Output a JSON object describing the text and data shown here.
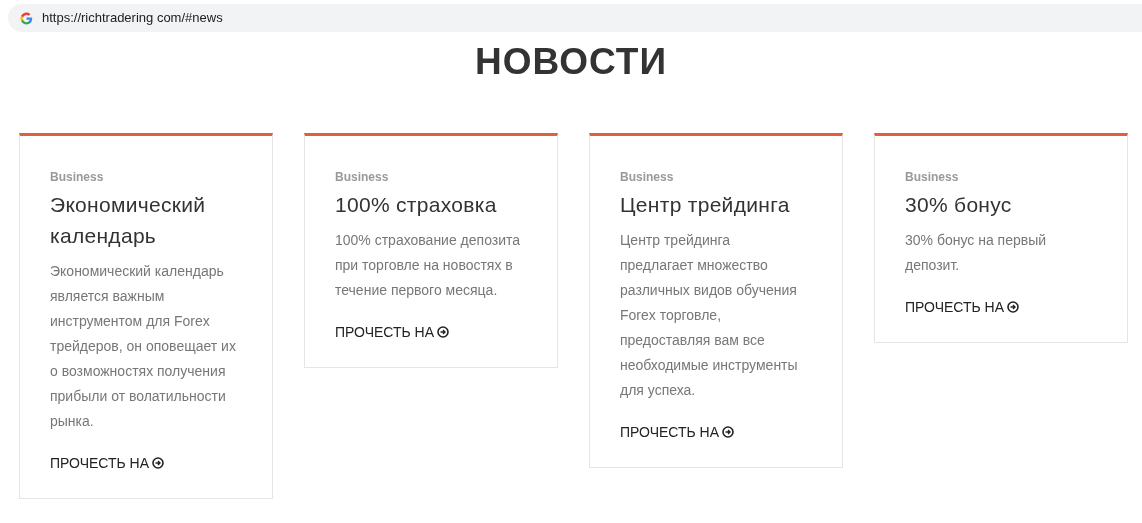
{
  "address_bar": {
    "url": "https://richtradering com/#news"
  },
  "heading": "НОВОСТИ",
  "cards": [
    {
      "category": "Business",
      "title": "Экономический календарь",
      "description": "Экономический календарь является важным инструментом для Forex трейдеров, он оповещает их о возможностях получения прибыли от волатильности рынка.",
      "link": "ПРОЧЕСТЬ НА"
    },
    {
      "category": "Business",
      "title": "100% страховка",
      "description": "100% страхование депозита при торговле на новостях в течение первого месяца.",
      "link": "ПРОЧЕСТЬ НА"
    },
    {
      "category": "Business",
      "title": "Центр трейдинга",
      "description": "Центр трейдинга предлагает множество различных видов обучения Forex торговле, предоставляя вам все необходимые инструменты для успеха.",
      "link": "ПРОЧЕСТЬ НА"
    },
    {
      "category": "Business",
      "title": "30% бонус",
      "description": "30% бонус на первый депозит.",
      "link": "ПРОЧЕСТЬ НА"
    }
  ]
}
